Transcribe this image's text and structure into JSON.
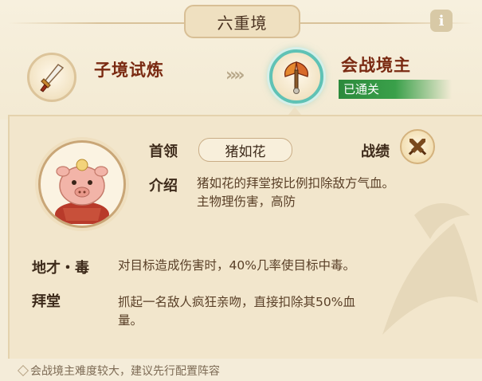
{
  "header": {
    "title": "六重境",
    "info_label": "i"
  },
  "stages": {
    "previous": {
      "label": "子境试炼",
      "icon": "sword-icon"
    },
    "arrows": "»",
    "current": {
      "label": "会战境主",
      "icon": "battle-axe-icon",
      "status": "已通关"
    }
  },
  "boss": {
    "leader_label": "首领",
    "name": "猪如花",
    "record_label": "战绩",
    "record_icon": "crossed-swords-icon",
    "intro_label": "介绍",
    "intro_line1": "猪如花的拜堂按比例扣除敌方气血。",
    "intro_line2": "主物理伤害，高防"
  },
  "traits": [
    {
      "name": "地才・毒",
      "desc_line1": "对目标造成伤害时，40%几率使目标中毒。",
      "desc_line2": ""
    },
    {
      "name": "拜堂",
      "desc_line1": "抓起一名敌人疯狂亲吻，直接扣除其50%血",
      "desc_line2": "量。"
    }
  ],
  "footer": {
    "tip": "会战境主难度较大，建议先行配置阵容"
  },
  "colors": {
    "cleared_green": "#3aa04a",
    "current_ring": "#5fc2b5",
    "stage_label": "#7a2a12",
    "background": "#f4ecd9"
  }
}
